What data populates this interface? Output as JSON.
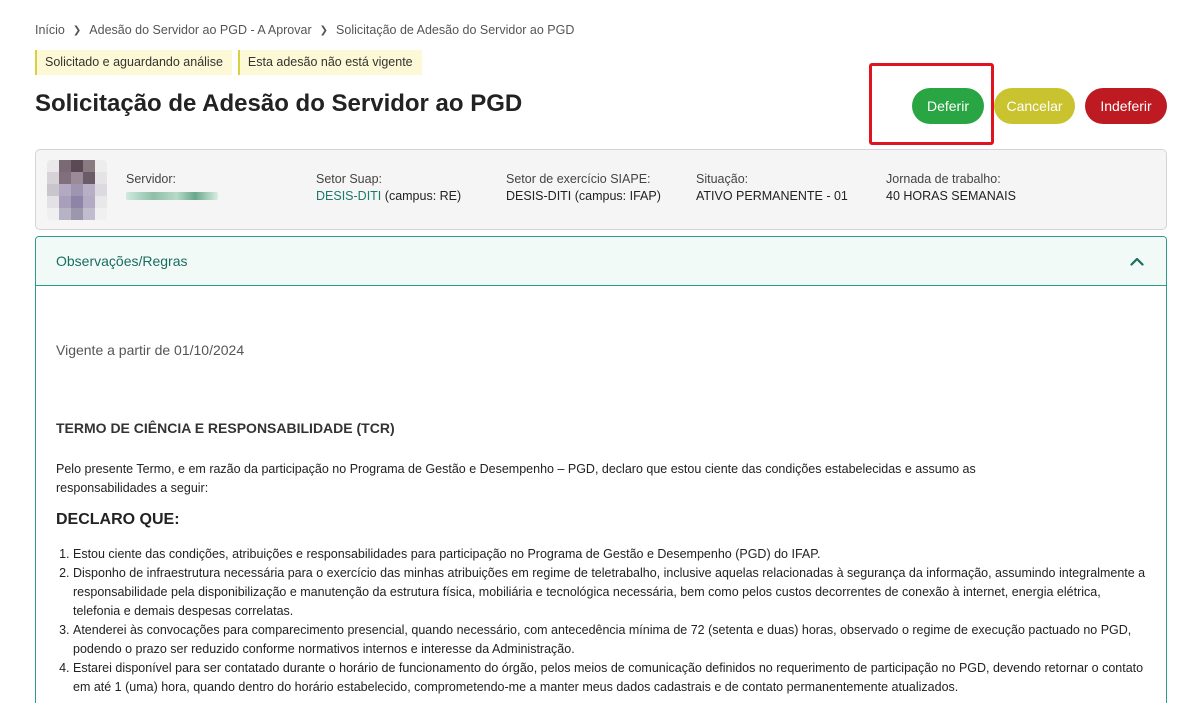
{
  "breadcrumb": {
    "items": [
      "Início",
      "Adesão do Servidor ao PGD - A Aprovar",
      "Solicitação de Adesão do Servidor ao PGD"
    ]
  },
  "badges": [
    "Solicitado e aguardando análise",
    "Esta adesão não está vigente"
  ],
  "page_title": "Solicitação de Adesão do Servidor ao PGD",
  "actions": {
    "approve_label": "Deferir",
    "cancel_label": "Cancelar",
    "reject_label": "Indeferir"
  },
  "colors": {
    "approve": "#2aa543",
    "cancel": "#c9c32f",
    "reject": "#bd1a22",
    "highlight": "#e0141e",
    "accent": "#2e9b85"
  },
  "profile": {
    "servidor_label": "Servidor:",
    "setor_suap_label": "Setor Suap:",
    "setor_suap_link": "DESIS-DITI",
    "setor_suap_suffix": "(campus: RE)",
    "setor_siape_label": "Setor de exercício SIAPE:",
    "setor_siape_value": "DESIS-DITI (campus: IFAP)",
    "situacao_label": "Situação:",
    "situacao_value": "ATIVO PERMANENTE - 01",
    "jornada_label": "Jornada de trabalho:",
    "jornada_value": "40 HORAS SEMANAIS"
  },
  "accordion": {
    "title": "Observações/Regras",
    "chevron_icon": "chevron-up-icon",
    "vigente": "Vigente a partir de 01/10/2024",
    "tcr_title": "TERMO DE CIÊNCIA E RESPONSABILIDADE (TCR)",
    "intro": "Pelo presente Termo, e em razão da participação no Programa de Gestão e Desempenho – PGD, declaro que estou ciente das condições estabelecidas e assumo as responsabilidades a seguir:",
    "declaro": "DECLARO QUE:",
    "rules": [
      "Estou ciente das condições, atribuições e responsabilidades para participação no Programa de Gestão e Desempenho (PGD) do IFAP.",
      "Disponho de infraestrutura necessária para o exercício das minhas atribuições em regime de teletrabalho, inclusive aquelas relacionadas à segurança da informação, assumindo integralmente a responsabilidade pela disponibilização e manutenção da estrutura física, mobiliária e tecnológica necessária, bem como pelos custos decorrentes de conexão à internet, energia elétrica, telefonia e demais despesas correlatas.",
      "Atenderei às convocações para comparecimento presencial, quando necessário, com antecedência mínima de 72 (setenta e duas) horas, observado o regime de execução pactuado no PGD, podendo o prazo ser reduzido conforme normativos internos e interesse da Administração.",
      "Estarei disponível para ser contatado durante o horário de funcionamento do órgão, pelos meios de comunicação definidos no requerimento de participação no PGD, devendo retornar o contato em até 1 (uma) hora, quando dentro do horário estabelecido, comprometendo-me a manter meus dados cadastrais e de contato permanentemente atualizados."
    ]
  }
}
